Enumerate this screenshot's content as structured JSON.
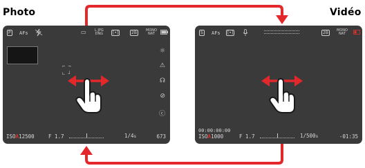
{
  "headings": {
    "photo": "Photo",
    "video": "Vidéo"
  },
  "photo_screen": {
    "top_bar": {
      "mode": "P",
      "focus": "AFs",
      "drive_top": "L",
      "drive_bottom": "DNG",
      "format_top": "L JPG",
      "format_bottom": "DNG",
      "storage": "2B",
      "look_top": "MONO",
      "look_bottom": "NAT"
    },
    "bottom_bar": {
      "iso_prefix": "ISO",
      "iso_a": "A",
      "iso_value": "12500",
      "aperture": "F 1.7",
      "shutter": "1/4",
      "shutter_unit": "s",
      "shots": "673"
    }
  },
  "video_screen": {
    "top_bar": {
      "mode": "S",
      "focus": "AFs",
      "storage": "2B",
      "look_top": "MONO",
      "look_bottom": "NAT"
    },
    "bottom_bar": {
      "timecode": "00:00:00:00",
      "iso_prefix": "ISO",
      "iso_a": "A",
      "iso_value": "1000",
      "aperture": "F 1.7",
      "shutter": "1/500",
      "shutter_unit": "s",
      "remaining": "-01:35"
    }
  },
  "colors": {
    "arrow": "#e3282c",
    "screen": "#3a3a3a",
    "iso_accent": "#e0302c"
  },
  "icons": [
    "swipe-gesture-icon",
    "hand-pointer-icon",
    "horizontal-arrow-icon",
    "cycle-arrow-icon"
  ]
}
